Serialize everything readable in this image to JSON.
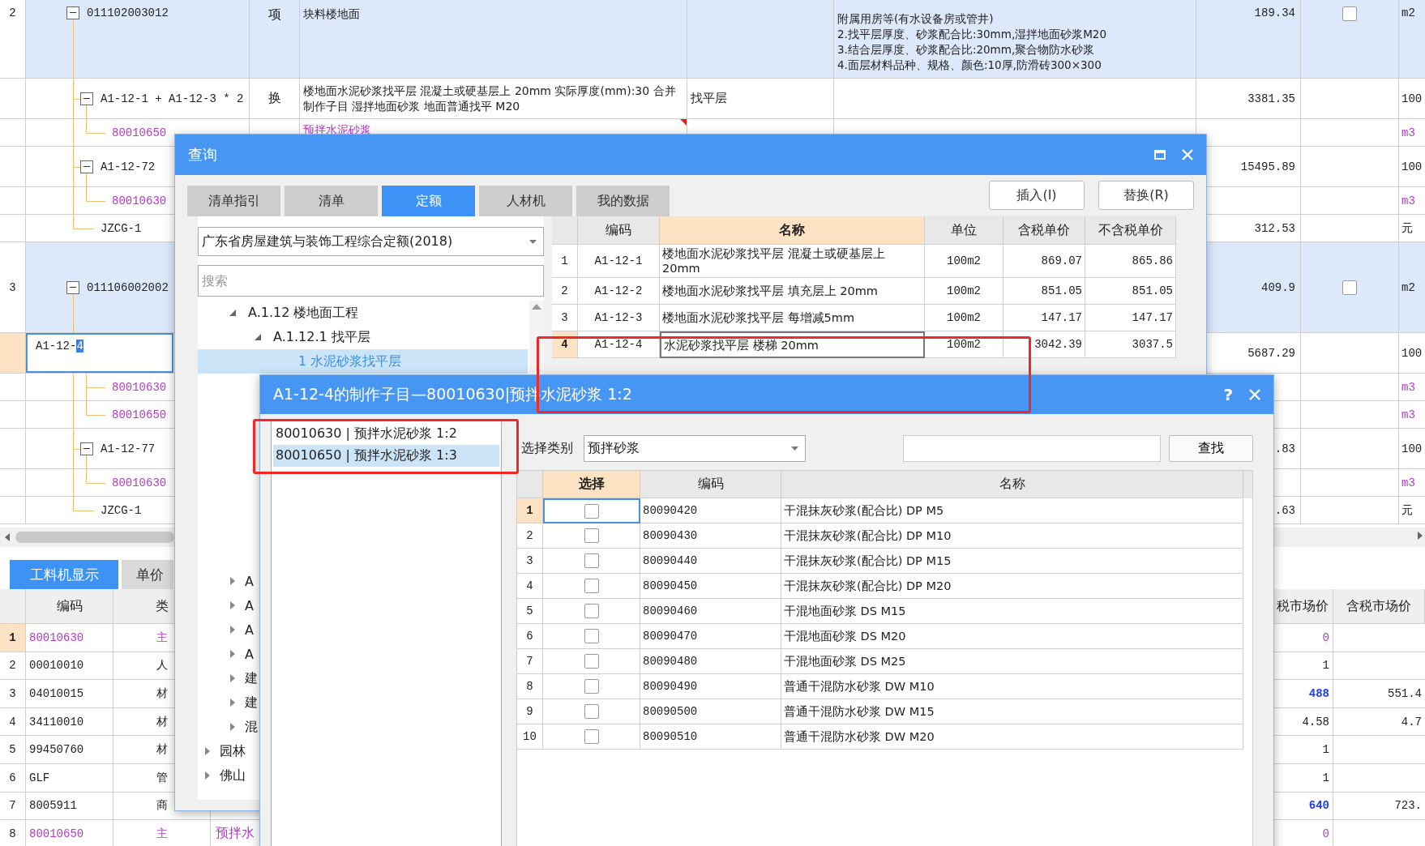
{
  "main_grid": {
    "rows": [
      {
        "no": "2",
        "code": "011102003012",
        "kind": "bill",
        "expanded": true,
        "selected": false,
        "type": "项",
        "name": "块料楼地面",
        "desc": [
          "附属用房等(有水设备房或管井)",
          "2.找平层厚度、砂浆配合比:30mm,湿拌地面砂浆M20",
          "3.结合层厚度、砂浆配合比:20mm,聚合物防水砂浆",
          "4.面层材料品种、规格、颜色:10厚,防滑砖300×300"
        ],
        "value": "189.34",
        "checked": false,
        "unit": "m2",
        "children": [
          {
            "code": "A1-12-1 + A1-12-3 * 2",
            "kind": "quota",
            "expanded": true,
            "selected": false,
            "type": "换",
            "name": "楼地面水泥砂浆找平层 混凝土或硬基层上 20mm  实际厚度(mm):30  合并制作子目 湿拌地面砂浆 地面普通找平 M20",
            "feature": "找平层",
            "value": "3381.35",
            "unit": "100",
            "children": [
              {
                "code": "80010650",
                "kind": "material",
                "selected": false,
                "name": "预拌水泥砂浆",
                "note": true,
                "unit": "m3"
              }
            ]
          },
          {
            "code": "A1-12-72",
            "kind": "quota",
            "expanded": true,
            "selected": false,
            "value": "15495.89",
            "unit": "100",
            "children": [
              {
                "code": "80010630",
                "kind": "material",
                "selected": false,
                "unit": "m3"
              }
            ]
          },
          {
            "code": "JZCG-1",
            "kind": "other",
            "selected": false,
            "value": "312.53",
            "unit": "元"
          }
        ]
      },
      {
        "no": "3",
        "code": "011106002002",
        "kind": "bill",
        "expanded": true,
        "selected": false,
        "value": "409.9",
        "checked": false,
        "unit": "m2",
        "children": [
          {
            "code": "A1-12-4",
            "kind": "quota",
            "selected": true,
            "editing": true,
            "value": "5687.29",
            "unit": "100",
            "children": [
              {
                "code": "80010630",
                "kind": "material",
                "selected": false,
                "unit": "m3"
              },
              {
                "code": "80010650",
                "kind": "material",
                "selected": false,
                "unit": "m3"
              }
            ]
          },
          {
            "code": "A1-12-77",
            "kind": "quota",
            "expanded": true,
            "selected": false,
            "value": ".83",
            "unit": "100",
            "children": [
              {
                "code": "80010630",
                "kind": "material",
                "selected": false,
                "unit": "m3"
              }
            ]
          },
          {
            "code": "JZCG-1",
            "kind": "other",
            "selected": false,
            "value": ".63",
            "unit": "元"
          }
        ]
      }
    ]
  },
  "bottom_panel": {
    "tabs": [
      {
        "label": "工料机显示",
        "selected": true
      },
      {
        "label": "单价",
        "selected": false
      }
    ],
    "columns": [
      "编码",
      "类",
      "税市场价",
      "含税市场价"
    ],
    "rows": [
      {
        "no": "1",
        "code": "80010630",
        "type": "主",
        "kind": "main",
        "selected": true,
        "market_price": "0"
      },
      {
        "no": "2",
        "code": "00010010",
        "type": "人",
        "kind": "other",
        "selected": false,
        "market_price": "1"
      },
      {
        "no": "3",
        "code": "04010015",
        "type": "材",
        "kind": "other",
        "selected": false,
        "market_price": "488",
        "emphasis": true,
        "tax_price": "551.4"
      },
      {
        "no": "4",
        "code": "34110010",
        "type": "材",
        "kind": "other",
        "selected": false,
        "market_price": "4.58",
        "tax_price": "4.7"
      },
      {
        "no": "5",
        "code": "99450760",
        "type": "材",
        "kind": "other",
        "selected": false,
        "market_price": "1"
      },
      {
        "no": "6",
        "code": "GLF",
        "type": "管",
        "kind": "other",
        "selected": false,
        "market_price": "1"
      },
      {
        "no": "7",
        "code": "8005911",
        "type": "商",
        "kind": "other",
        "selected": false,
        "market_price": "640",
        "emphasis": true,
        "tax_price": "723."
      },
      {
        "no": "8",
        "code": "80010650",
        "type": "主",
        "kind": "main",
        "selected": false,
        "name": "预拌水",
        "market_price": "0"
      }
    ]
  },
  "query_dialog": {
    "title": "查询",
    "tabs": [
      {
        "label": "清单指引",
        "selected": false
      },
      {
        "label": "清单",
        "selected": false
      },
      {
        "label": "定额",
        "selected": true
      },
      {
        "label": "人材机",
        "selected": false
      },
      {
        "label": "我的数据",
        "selected": false
      }
    ],
    "buttons": [
      "插入(I)",
      "替换(R)"
    ],
    "library": "广东省房屋建筑与装饰工程综合定额(2018)",
    "search": {
      "placeholder": "搜索"
    },
    "tree": [
      {
        "label": "A.1.12 楼地面工程",
        "expanded": true,
        "selected": false,
        "children": [
          {
            "label": "A.1.12.1 找平层",
            "expanded": true,
            "selected": false,
            "children": [
              {
                "label": "1 水泥砂浆找平层",
                "selected": true
              }
            ]
          }
        ]
      }
    ],
    "tree_lower": [
      {
        "label": "A",
        "expanded": false
      },
      {
        "label": "A",
        "expanded": false
      },
      {
        "label": "A",
        "expanded": false
      },
      {
        "label": "A",
        "expanded": false
      },
      {
        "label": "建",
        "expanded": false
      },
      {
        "label": "建",
        "expanded": false
      },
      {
        "label": "混",
        "expanded": false
      }
    ],
    "libraries": [
      {
        "label": "园林",
        "expanded": false
      },
      {
        "label": "佛山",
        "expanded": false
      }
    ],
    "table": {
      "columns": [
        {
          "label": "编码",
          "selected": false
        },
        {
          "label": "名称",
          "selected": true
        },
        {
          "label": "单位",
          "selected": false
        },
        {
          "label": "含税单价",
          "selected": false
        },
        {
          "label": "不含税单价",
          "selected": false
        }
      ],
      "rows": [
        {
          "no": "1",
          "code": "A1-12-1",
          "name": "楼地面水泥砂浆找平层 混凝土或硬基层上 20mm",
          "unit": "100m2",
          "price": "869.07",
          "price_ex": "865.86",
          "selected": false
        },
        {
          "no": "2",
          "code": "A1-12-2",
          "name": "楼地面水泥砂浆找平层 填充层上 20mm",
          "unit": "100m2",
          "price": "851.05",
          "price_ex": "851.05",
          "selected": false
        },
        {
          "no": "3",
          "code": "A1-12-3",
          "name": "楼地面水泥砂浆找平层 每增减5mm",
          "unit": "100m2",
          "price": "147.17",
          "price_ex": "147.17",
          "selected": false
        },
        {
          "no": "4",
          "code": "A1-12-4",
          "name": "水泥砂浆找平层 楼梯 20mm",
          "unit": "100m2",
          "price": "3042.39",
          "price_ex": "3037.5",
          "selected": true
        }
      ]
    }
  },
  "sub_dialog": {
    "title": "A1-12-4的制作子目—80010630|预拌水泥砂浆 1:2",
    "help": "?",
    "items": [
      {
        "label": "80010630 | 预拌水泥砂浆 1:2",
        "selected": false
      },
      {
        "label": "80010650 | 预拌水泥砂浆 1:3",
        "selected": true
      }
    ],
    "filter_label": "选择类别",
    "filter_value": "预拌砂浆",
    "find_button": "查找",
    "table": {
      "columns": [
        {
          "label": "选择",
          "selected": true
        },
        {
          "label": "编码",
          "selected": false
        },
        {
          "label": "名称",
          "selected": false
        }
      ],
      "rows": [
        {
          "no": "1",
          "code": "80090420",
          "name": "干混抹灰砂浆(配合比) DP M5",
          "checked": false,
          "selected": true
        },
        {
          "no": "2",
          "code": "80090430",
          "name": "干混抹灰砂浆(配合比) DP M10",
          "checked": false,
          "selected": false
        },
        {
          "no": "3",
          "code": "80090440",
          "name": "干混抹灰砂浆(配合比) DP M15",
          "checked": false,
          "selected": false
        },
        {
          "no": "4",
          "code": "80090450",
          "name": "干混抹灰砂浆(配合比) DP M20",
          "checked": false,
          "selected": false
        },
        {
          "no": "5",
          "code": "80090460",
          "name": "干混地面砂浆 DS M15",
          "checked": false,
          "selected": false
        },
        {
          "no": "6",
          "code": "80090470",
          "name": "干混地面砂浆 DS M20",
          "checked": false,
          "selected": false
        },
        {
          "no": "7",
          "code": "80090480",
          "name": "干混地面砂浆 DS M25",
          "checked": false,
          "selected": false
        },
        {
          "no": "8",
          "code": "80090490",
          "name": "普通干混防水砂浆 DW M10",
          "checked": false,
          "selected": false
        },
        {
          "no": "9",
          "code": "80090500",
          "name": "普通干混防水砂浆 DW M15",
          "checked": false,
          "selected": false
        },
        {
          "no": "10",
          "code": "80090510",
          "name": "普通干混防水砂浆 DW M20",
          "checked": false,
          "selected": false
        }
      ]
    }
  }
}
